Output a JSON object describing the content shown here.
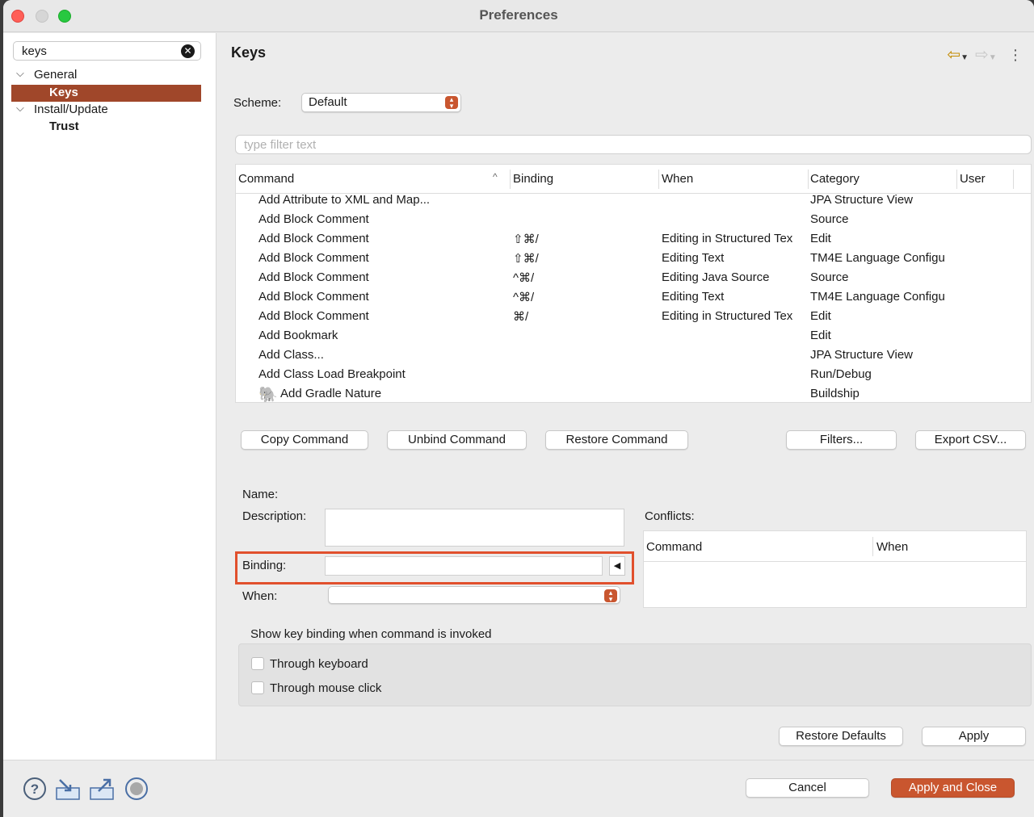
{
  "window": {
    "title": "Preferences"
  },
  "sidebar": {
    "search_value": "keys",
    "tree": [
      {
        "label": "General",
        "level": 0,
        "expanded": true
      },
      {
        "label": "Keys",
        "level": 1,
        "selected": true
      },
      {
        "label": "Install/Update",
        "level": 0,
        "expanded": true
      },
      {
        "label": "Trust",
        "level": 1
      }
    ]
  },
  "page": {
    "title": "Keys",
    "scheme_label": "Scheme:",
    "scheme_value": "Default",
    "filter_placeholder": "type filter text"
  },
  "table": {
    "columns": [
      "Command",
      "Binding",
      "When",
      "Category",
      "User"
    ],
    "rows": [
      {
        "command": "Add Attribute to XML and Map...",
        "binding": "",
        "when": "",
        "category": "JPA Structure View"
      },
      {
        "command": "Add Block Comment",
        "binding": "",
        "when": "",
        "category": "Source"
      },
      {
        "command": "Add Block Comment",
        "binding": "⇧⌘/",
        "when": "Editing in Structured Tex",
        "category": "Edit"
      },
      {
        "command": "Add Block Comment",
        "binding": "⇧⌘/",
        "when": "Editing Text",
        "category": "TM4E Language Configu"
      },
      {
        "command": "Add Block Comment",
        "binding": "^⌘/",
        "when": "Editing Java Source",
        "category": "Source"
      },
      {
        "command": "Add Block Comment",
        "binding": "^⌘/",
        "when": "Editing Text",
        "category": "TM4E Language Configu"
      },
      {
        "command": "Add Block Comment",
        "binding": "⌘/",
        "when": "Editing in Structured Tex",
        "category": "Edit"
      },
      {
        "command": "Add Bookmark",
        "binding": "",
        "when": "",
        "category": "Edit"
      },
      {
        "command": "Add Class...",
        "binding": "",
        "when": "",
        "category": "JPA Structure View"
      },
      {
        "command": "Add Class Load Breakpoint",
        "binding": "",
        "when": "",
        "category": "Run/Debug"
      },
      {
        "command": "Add Gradle Nature",
        "binding": "",
        "when": "",
        "category": "Buildship",
        "icon": "gradle-elephant-icon"
      }
    ]
  },
  "buttons": {
    "copy": "Copy Command",
    "unbind": "Unbind Command",
    "restore": "Restore Command",
    "filters": "Filters...",
    "export": "Export CSV...",
    "restore_defaults": "Restore Defaults",
    "apply": "Apply",
    "cancel": "Cancel",
    "apply_close": "Apply and Close"
  },
  "details": {
    "name_label": "Name:",
    "description_label": "Description:",
    "binding_label": "Binding:",
    "binding_value": "",
    "when_label": "When:",
    "when_value": "",
    "conflicts_label": "Conflicts:",
    "conflicts_columns": [
      "Command",
      "When"
    ]
  },
  "show_binding": {
    "title": "Show key binding when command is invoked",
    "keyboard_label": "Through keyboard",
    "keyboard_checked": false,
    "mouse_label": "Through mouse click",
    "mouse_checked": false
  },
  "footer_icons": [
    "help-icon",
    "import-icon",
    "export-icon",
    "stop-icon"
  ],
  "colors": {
    "accent": "#c9562f",
    "selection": "#a0472a",
    "highlight_border": "#e1502d"
  }
}
